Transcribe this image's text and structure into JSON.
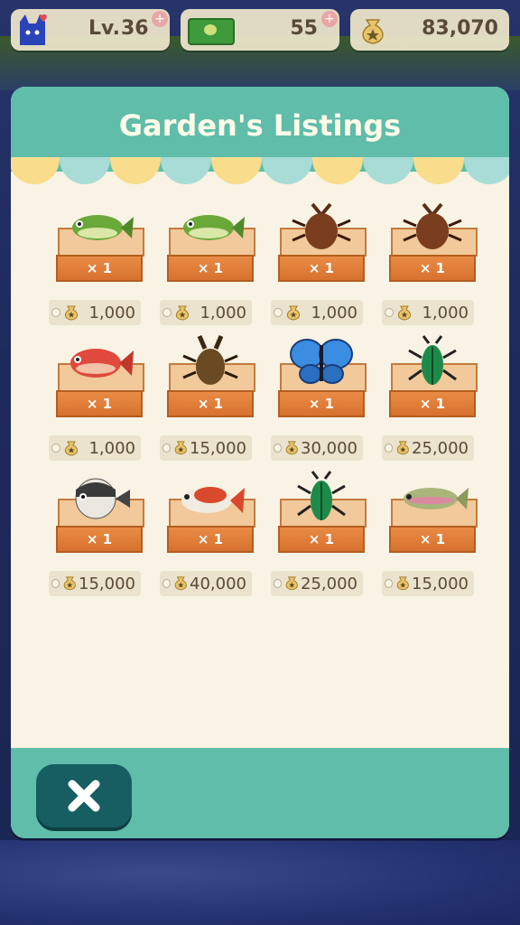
{
  "status": {
    "level_label": "Lv.",
    "level_value": "36",
    "tickets": "55",
    "bells": "83,070"
  },
  "modal": {
    "title": "Garden's Listings",
    "close_icon": "close-x-icon"
  },
  "colors": {
    "teal": "#5fbda9",
    "cream": "#f8f3e4",
    "scallop_yellow": "#f9dc8c",
    "scallop_blue": "#a9dcd6",
    "close_button": "#175e63"
  },
  "listings": [
    {
      "item": "bass-icon",
      "qty": "× 1",
      "price": "1,000"
    },
    {
      "item": "bass-icon",
      "qty": "× 1",
      "price": "1,000"
    },
    {
      "item": "rhino-beetle-icon",
      "qty": "× 1",
      "price": "1,000"
    },
    {
      "item": "rhino-beetle-icon",
      "qty": "× 1",
      "price": "1,000"
    },
    {
      "item": "red-snapper-icon",
      "qty": "× 1",
      "price": "1,000"
    },
    {
      "item": "stag-beetle-icon",
      "qty": "× 1",
      "price": "15,000"
    },
    {
      "item": "blue-butterfly-icon",
      "qty": "× 1",
      "price": "30,000"
    },
    {
      "item": "jewel-beetle-icon",
      "qty": "× 1",
      "price": "25,000"
    },
    {
      "item": "puffer-fish-icon",
      "qty": "× 1",
      "price": "15,000"
    },
    {
      "item": "koi-fish-icon",
      "qty": "× 1",
      "price": "40,000"
    },
    {
      "item": "jewel-beetle-icon",
      "qty": "× 1",
      "price": "25,000"
    },
    {
      "item": "trout-icon",
      "qty": "× 1",
      "price": "15,000"
    }
  ]
}
